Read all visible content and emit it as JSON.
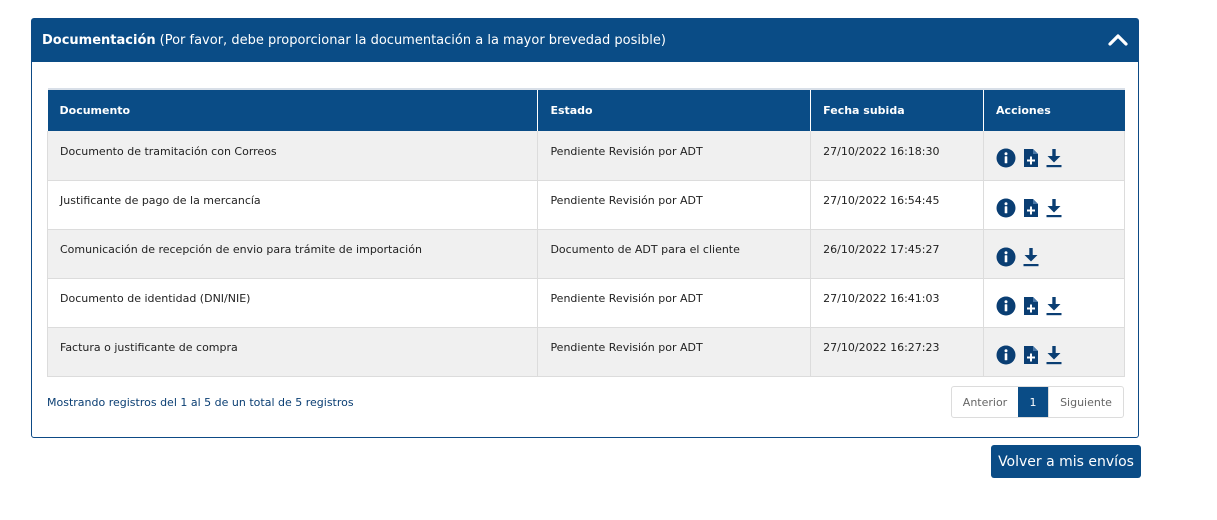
{
  "panel": {
    "title": "Documentación",
    "subtitle": "(Por favor, debe proporcionar la documentación a la mayor brevedad posible)",
    "collapse_icon": "chevron-up-icon"
  },
  "table": {
    "headers": {
      "documento": "Documento",
      "estado": "Estado",
      "fecha": "Fecha subida",
      "acciones": "Acciones"
    },
    "rows": [
      {
        "documento": "Documento de tramitación con Correos",
        "estado": "Pendiente Revisión por ADT",
        "fecha": "27/10/2022 16:18:30",
        "actions": [
          "info-icon",
          "add-file-icon",
          "download-icon"
        ]
      },
      {
        "documento": "Justificante de pago de la mercancía",
        "estado": "Pendiente Revisión por ADT",
        "fecha": "27/10/2022 16:54:45",
        "actions": [
          "info-icon",
          "add-file-icon",
          "download-icon"
        ]
      },
      {
        "documento": "Comunicación de recepción de envio para trámite de importación",
        "estado": "Documento de ADT para el cliente",
        "fecha": "26/10/2022 17:45:27",
        "actions": [
          "info-icon",
          "download-icon"
        ]
      },
      {
        "documento": "Documento de identidad (DNI/NIE)",
        "estado": "Pendiente Revisión por ADT",
        "fecha": "27/10/2022 16:41:03",
        "actions": [
          "info-icon",
          "add-file-icon",
          "download-icon"
        ]
      },
      {
        "documento": "Factura o justificante de compra",
        "estado": "Pendiente Revisión por ADT",
        "fecha": "27/10/2022 16:27:23",
        "actions": [
          "info-icon",
          "add-file-icon",
          "download-icon"
        ]
      }
    ]
  },
  "footer": {
    "info": "Mostrando registros del 1 al 5 de un total de 5 registros",
    "pager": {
      "prev": "Anterior",
      "current": "1",
      "next": "Siguiente"
    }
  },
  "back_button": "Volver a mis envíos",
  "colors": {
    "primary": "#0a4c86",
    "row_alt": "#f0f0f0"
  }
}
